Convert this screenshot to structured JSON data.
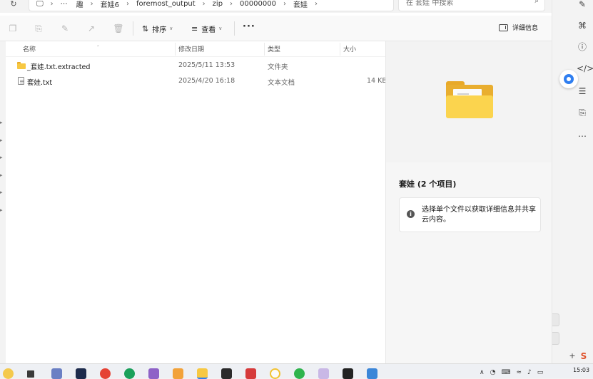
{
  "address": {
    "crumbs": [
      "趣",
      "套娃6",
      "foremost_output",
      "zip",
      "00000000",
      "套娃"
    ],
    "overflow": "⋯",
    "separator": "›",
    "search_placeholder": "在 套娃 中搜索"
  },
  "toolbar": {
    "sort_label": "排序",
    "view_label": "查看",
    "more_label": "···",
    "details_label": "详细信息"
  },
  "columns": {
    "name": "名称",
    "date": "修改日期",
    "type": "类型",
    "size": "大小"
  },
  "files": [
    {
      "name": "_套娃.txt.extracted",
      "date": "2025/5/11 13:53",
      "type": "文件夹",
      "size": "",
      "icon": "folder-icon"
    },
    {
      "name": "套娃.txt",
      "date": "2025/4/20 16:18",
      "type": "文本文档",
      "size": "14 KB",
      "icon": "text-file-icon"
    }
  ],
  "details": {
    "title": "套娃 (2 个项目)",
    "info": "选择单个文件以获取详细信息并共享云内容。"
  },
  "taskbar": {
    "time": "15:03"
  },
  "colors": {
    "folder_yellow": "#f7c842",
    "accent_blue": "#2f7ef0"
  }
}
